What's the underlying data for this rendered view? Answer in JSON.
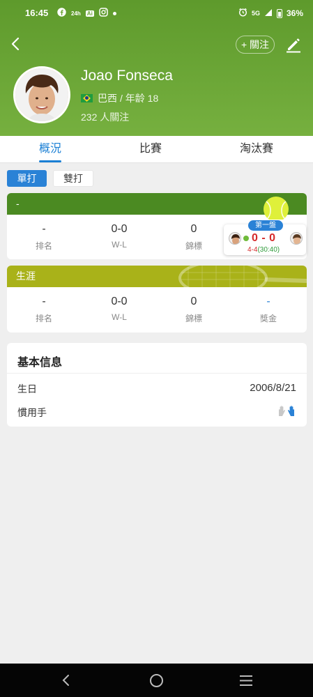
{
  "status_bar": {
    "time": "16:45",
    "network": "5G",
    "battery": "36%",
    "icons_left": [
      "facebook-icon",
      "24h-icon",
      "ai-icon",
      "instagram-icon",
      "dot-icon"
    ],
    "icons_right": [
      "alarm-icon",
      "signal-icon",
      "battery-icon"
    ]
  },
  "header": {
    "follow_label": "+ 關注",
    "player_name": "Joao Fonseca",
    "country": "巴西",
    "age_text": "/ 年龄 18",
    "followers": "232 人關注"
  },
  "tabs": [
    {
      "label": "概況",
      "active": true
    },
    {
      "label": "比賽",
      "active": false
    },
    {
      "label": "淘汰賽",
      "active": false
    }
  ],
  "segments": {
    "singles": "單打",
    "doubles": "雙打"
  },
  "current_card": {
    "title": "-",
    "stats": [
      {
        "value": "-",
        "label": "排名"
      },
      {
        "value": "0-0",
        "label": "W-L"
      },
      {
        "value": "0",
        "label": "錦標"
      }
    ]
  },
  "live_match": {
    "badge": "第一盤",
    "score": "0 - 0",
    "games": "4-4",
    "points": "(30:40)"
  },
  "career_card": {
    "title": "生涯",
    "stats": [
      {
        "value": "-",
        "label": "排名"
      },
      {
        "value": "0-0",
        "label": "W-L"
      },
      {
        "value": "0",
        "label": "錦標"
      },
      {
        "value": "-",
        "label": "獎金"
      }
    ]
  },
  "basic_info": {
    "title": "基本信息",
    "rows": [
      {
        "label": "生日",
        "value": "2006/8/21"
      },
      {
        "label": "慣用手",
        "value_icon": "hands-icon"
      }
    ]
  },
  "colors": {
    "header_green": "#6aa535",
    "accent_blue": "#2a82d6",
    "card_green": "#4b8a22",
    "career_olive": "#a9b219",
    "score_red": "#d52a2a"
  }
}
